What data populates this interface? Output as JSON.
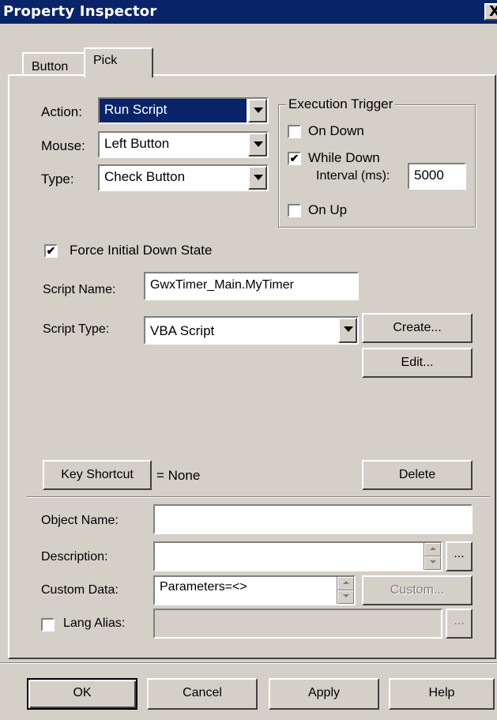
{
  "window": {
    "title": "Property Inspector",
    "close_label": "X"
  },
  "tabs": [
    {
      "label": "Button",
      "active": false
    },
    {
      "label": "Pick",
      "active": true
    }
  ],
  "pick": {
    "action_label": "Action:",
    "action_value": "Run Script",
    "mouse_label": "Mouse:",
    "mouse_value": "Left Button",
    "type_label": "Type:",
    "type_value": "Check Button",
    "execution_trigger": {
      "title": "Execution Trigger",
      "on_down_label": "On Down",
      "on_down_checked": false,
      "while_down_label": "While Down",
      "while_down_checked": true,
      "interval_label": "Interval (ms):",
      "interval_value": "5000",
      "on_up_label": "On Up",
      "on_up_checked": false
    },
    "force_initial_label": "Force Initial Down State",
    "force_initial_checked": true,
    "script_name_label": "Script Name:",
    "script_name_value": "GwxTimer_Main.MyTimer",
    "script_type_label": "Script Type:",
    "script_type_value": "VBA Script",
    "create_label": "Create...",
    "edit_label": "Edit..."
  },
  "shortcut": {
    "button_label": "Key Shortcut",
    "value_text": "= None",
    "delete_label": "Delete"
  },
  "object": {
    "name_label": "Object Name:",
    "name_value": "",
    "description_label": "Description:",
    "description_value": "",
    "ellipsis": "...",
    "custom_data_label": "Custom Data:",
    "custom_data_value": "Parameters=<>",
    "custom_button_label": "Custom...",
    "lang_alias_label": "Lang Alias:",
    "lang_alias_checked": false,
    "lang_alias_value": ""
  },
  "footer": {
    "ok_label": "OK",
    "cancel_label": "Cancel",
    "apply_label": "Apply",
    "help_label": "Help"
  },
  "colors": {
    "face": "#d4d0c8",
    "title_bar": "#0a246a",
    "selection": "#0a246a",
    "disabled_text": "#808080"
  }
}
